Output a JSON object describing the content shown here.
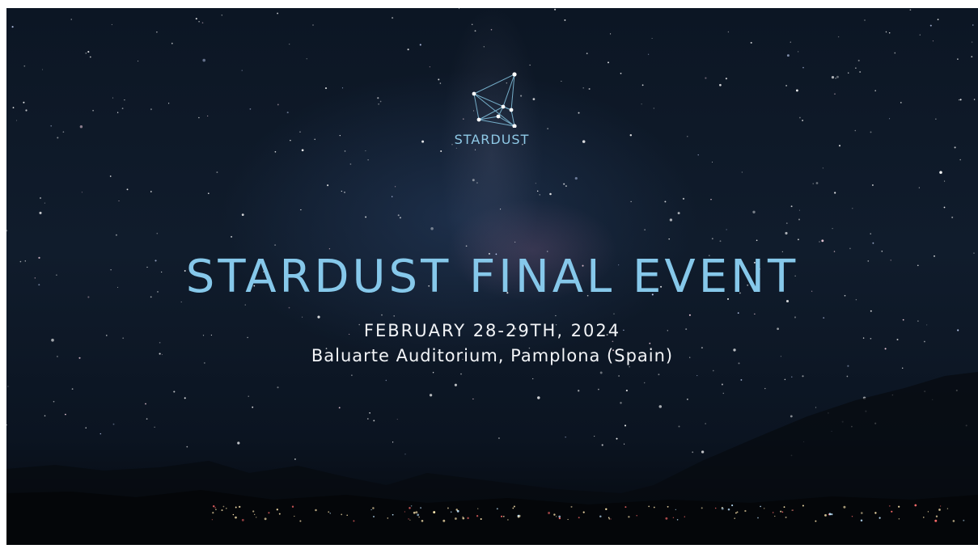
{
  "logo": {
    "icon": "constellation-icon",
    "text": "STARDUST"
  },
  "event": {
    "title": "STARDUST FINAL EVENT",
    "date": "FEBRUARY 28-29TH, 2024",
    "venue": "Baluarte Auditorium, Pamplona (Spain)"
  },
  "colors": {
    "accent": "#86c8ea",
    "text": "#f2f4f7",
    "sky": "#0f1b2b"
  }
}
